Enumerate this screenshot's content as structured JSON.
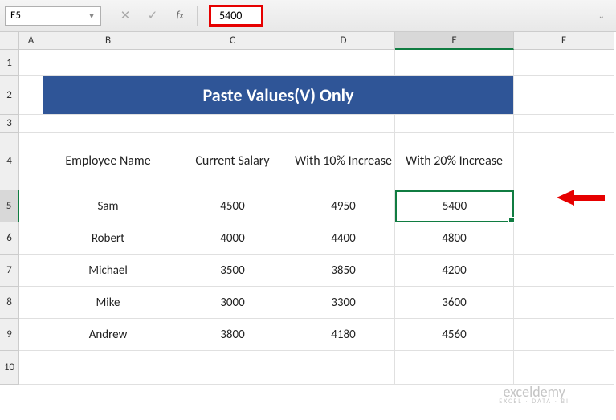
{
  "toolbar": {
    "cell_ref": "E5",
    "fx_label": "fx",
    "formula_value": "5400"
  },
  "columns": [
    "A",
    "B",
    "C",
    "D",
    "E",
    "F"
  ],
  "rows": [
    "1",
    "2",
    "3",
    "4",
    "5",
    "6",
    "7",
    "8",
    "9",
    "10"
  ],
  "title": "Paste Values(V) Only",
  "headers": {
    "b": "Employee Name",
    "c": "Current Salary",
    "d": "With 10% Increase",
    "e": "With 20% Increase"
  },
  "data": [
    {
      "name": "Sam",
      "salary": "4500",
      "inc10": "4950",
      "inc20": "5400"
    },
    {
      "name": "Robert",
      "salary": "4000",
      "inc10": "4400",
      "inc20": "4800"
    },
    {
      "name": "Michael",
      "salary": "3500",
      "inc10": "3850",
      "inc20": "4200"
    },
    {
      "name": "Mike",
      "salary": "3000",
      "inc10": "3300",
      "inc20": "3600"
    },
    {
      "name": "Andrew",
      "salary": "3800",
      "inc10": "4180",
      "inc20": "4560"
    }
  ],
  "selected_cell": "E5",
  "active_column": "E",
  "active_row": "5",
  "watermark": {
    "main": "exceldemy",
    "sub": "EXCEL · DATA · BI"
  }
}
